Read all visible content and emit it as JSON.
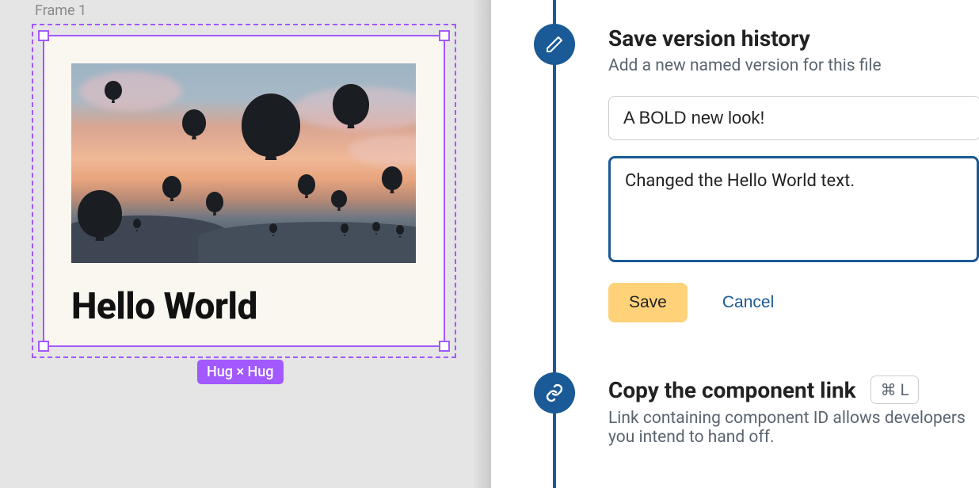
{
  "canvas": {
    "frame_label": "Frame 1",
    "card_title": "Hello World",
    "size_badge": "Hug × Hug"
  },
  "version": {
    "title": "Save version history",
    "subtitle": "Add a new named version for this file",
    "name_value": "A BOLD new look!",
    "desc_value": "Changed the Hello World text.",
    "save_label": "Save",
    "cancel_label": "Cancel"
  },
  "copy": {
    "title": "Copy the component link",
    "shortcut": "⌘ L",
    "subtitle": "Link containing component ID allows developers you intend to hand off."
  }
}
